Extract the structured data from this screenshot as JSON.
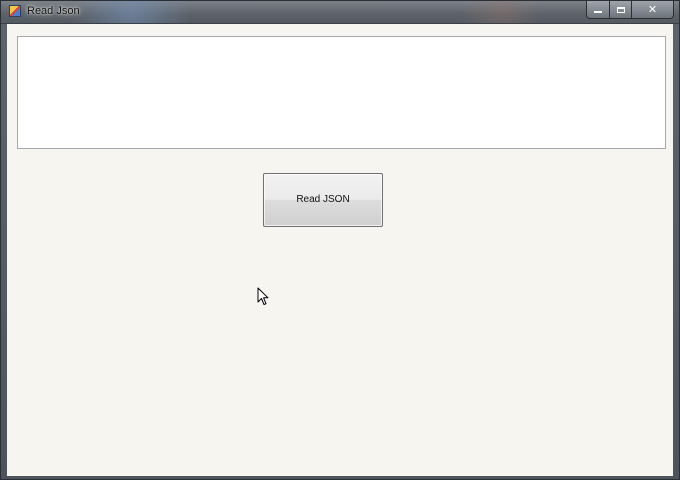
{
  "window": {
    "title": "Read Json",
    "icon": "app-form-icon",
    "controls": {
      "minimize_icon": "minimize-icon",
      "maximize_icon": "maximize-icon",
      "close_icon": "close-icon",
      "close_glyph": "✕"
    }
  },
  "output_box": {
    "value": "",
    "placeholder": ""
  },
  "read_button": {
    "label": "Read JSON"
  },
  "colors": {
    "client_background": "#f6f5ef",
    "textbox_background": "#ffffff",
    "titlebar": "#5c6269"
  },
  "cursor": {
    "icon": "arrow-cursor-icon"
  }
}
